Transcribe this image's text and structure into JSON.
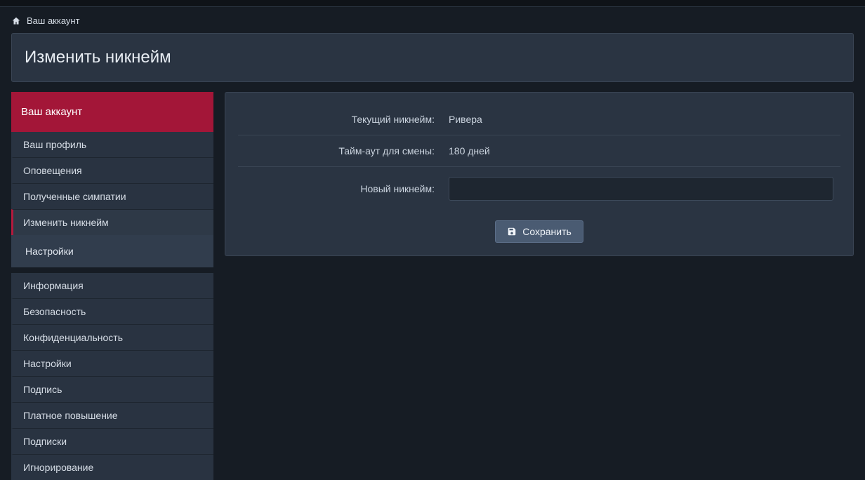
{
  "breadcrumb": {
    "label": "Ваш аккаунт"
  },
  "page": {
    "title": "Изменить никнейм"
  },
  "sidebar": {
    "header": "Ваш аккаунт",
    "group1": [
      {
        "label": "Ваш профиль"
      },
      {
        "label": "Оповещения"
      },
      {
        "label": "Полученные симпатии"
      },
      {
        "label": "Изменить никнейм",
        "active": true
      }
    ],
    "section": "Настройки",
    "group2": [
      {
        "label": "Информация"
      },
      {
        "label": "Безопасность"
      },
      {
        "label": "Конфиденциальность"
      },
      {
        "label": "Настройки"
      },
      {
        "label": "Подпись"
      },
      {
        "label": "Платное повышение"
      },
      {
        "label": "Подписки"
      },
      {
        "label": "Игнорирование"
      }
    ]
  },
  "form": {
    "current_label": "Текущий никнейм:",
    "current_value": "Ривера",
    "timeout_label": "Тайм-аут для смены:",
    "timeout_value": "180 дней",
    "new_label": "Новый никнейм:",
    "new_value": "",
    "save_label": "Сохранить"
  }
}
